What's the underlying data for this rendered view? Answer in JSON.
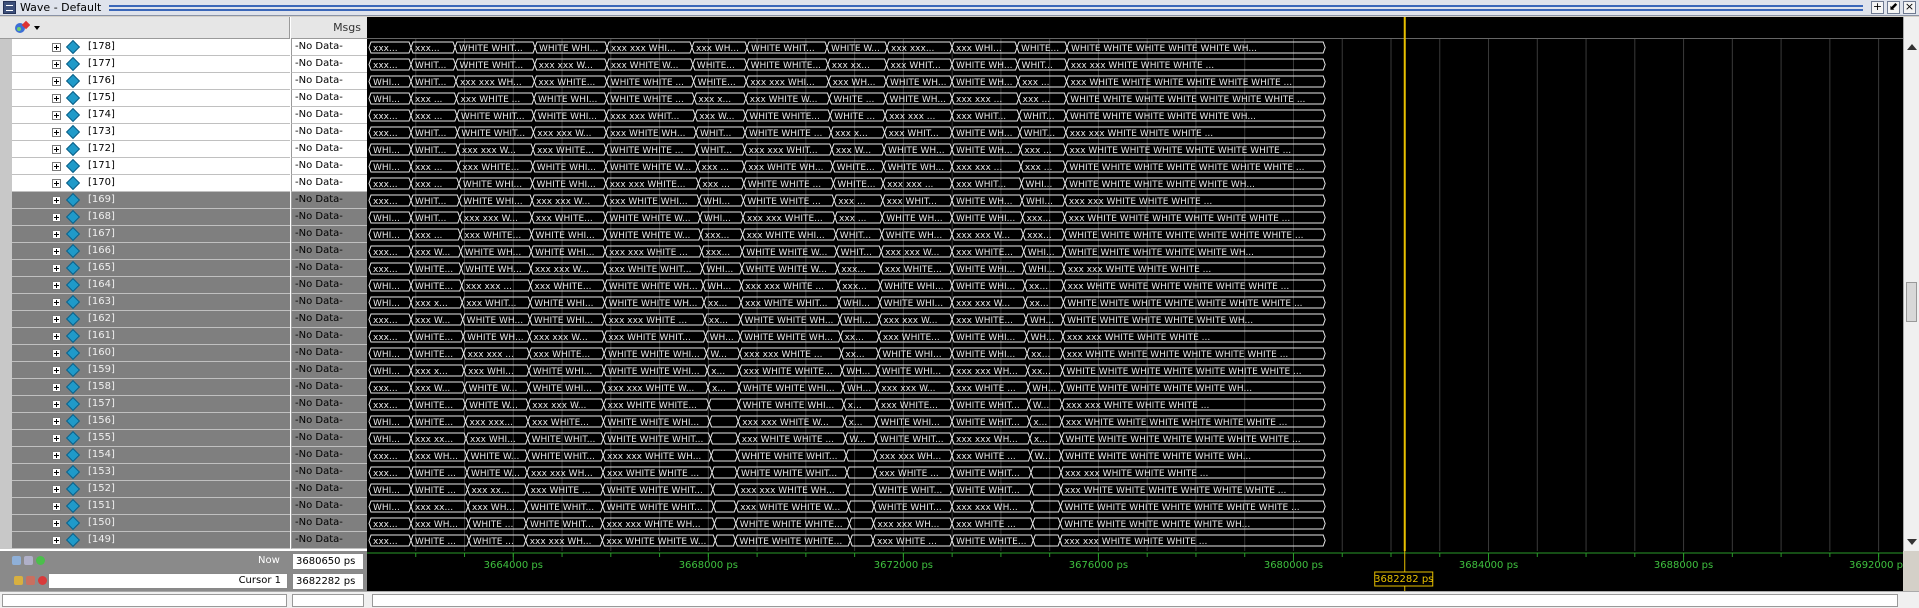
{
  "window": {
    "title": "Wave - Default"
  },
  "title_buttons": [
    "+",
    "⬋",
    "×"
  ],
  "header": {
    "msgs_label": "Msgs"
  },
  "signals": [
    {
      "name": "[178]",
      "msg": "-No Data-",
      "selected": false
    },
    {
      "name": "[177]",
      "msg": "-No Data-",
      "selected": false
    },
    {
      "name": "[176]",
      "msg": "-No Data-",
      "selected": false
    },
    {
      "name": "[175]",
      "msg": "-No Data-",
      "selected": false
    },
    {
      "name": "[174]",
      "msg": "-No Data-",
      "selected": false
    },
    {
      "name": "[173]",
      "msg": "-No Data-",
      "selected": false
    },
    {
      "name": "[172]",
      "msg": "-No Data-",
      "selected": false
    },
    {
      "name": "[171]",
      "msg": "-No Data-",
      "selected": false
    },
    {
      "name": "[170]",
      "msg": "-No Data-",
      "selected": false
    },
    {
      "name": "[169]",
      "msg": "-No Data-",
      "selected": true
    },
    {
      "name": "[168]",
      "msg": "-No Data-",
      "selected": true
    },
    {
      "name": "[167]",
      "msg": "-No Data-",
      "selected": true
    },
    {
      "name": "[166]",
      "msg": "-No Data-",
      "selected": true
    },
    {
      "name": "[165]",
      "msg": "-No Data-",
      "selected": true
    },
    {
      "name": "[164]",
      "msg": "-No Data-",
      "selected": true
    },
    {
      "name": "[163]",
      "msg": "-No Data-",
      "selected": true
    },
    {
      "name": "[162]",
      "msg": "-No Data-",
      "selected": true
    },
    {
      "name": "[161]",
      "msg": "-No Data-",
      "selected": true
    },
    {
      "name": "[160]",
      "msg": "-No Data-",
      "selected": true
    },
    {
      "name": "[159]",
      "msg": "-No Data-",
      "selected": true
    },
    {
      "name": "[158]",
      "msg": "-No Data-",
      "selected": true
    },
    {
      "name": "[157]",
      "msg": "-No Data-",
      "selected": true
    },
    {
      "name": "[156]",
      "msg": "-No Data-",
      "selected": true
    },
    {
      "name": "[155]",
      "msg": "-No Data-",
      "selected": true
    },
    {
      "name": "[154]",
      "msg": "-No Data-",
      "selected": true
    },
    {
      "name": "[153]",
      "msg": "-No Data-",
      "selected": true
    },
    {
      "name": "[152]",
      "msg": "-No Data-",
      "selected": true
    },
    {
      "name": "[151]",
      "msg": "-No Data-",
      "selected": true
    },
    {
      "name": "[150]",
      "msg": "-No Data-",
      "selected": true
    },
    {
      "name": "[149]",
      "msg": "-No Data-",
      "selected": true
    }
  ],
  "wave": {
    "segment_texts": [
      "xxx xxx WHITE WHITE WHITE ...",
      "xxx WHITE WHITE WHITE WHITE WHITE WHITE ...",
      "WHITE WHITE WHITE WHITE WHITE WHITE WHITE ...",
      "WHITE WHITE WHITE WHITE WHITE WH..."
    ],
    "signal_color": "#e8e8e8",
    "grid_color": "#3a3a3a",
    "cursor_color": "#e8c000",
    "data_end_ps": 3680650,
    "cursor_ps": 3682282,
    "view_start_ps": 3661000,
    "view_end_ps": 3692500
  },
  "status": {
    "now_label": "Now",
    "now_value": "3680650 ps",
    "cursor_label": "Cursor 1",
    "cursor_value": "3682282 ps",
    "cursor_flag": "3682282 ps"
  },
  "timeline": {
    "ticks": [
      "3664000 ps",
      "3668000 ps",
      "3672000 ps",
      "3676000 ps",
      "3680000 ps",
      "3684000 ps",
      "3688000 ps",
      "3692000 ps"
    ],
    "tick_values_ps": [
      3664000,
      3668000,
      3672000,
      3676000,
      3680000,
      3684000,
      3688000,
      3692000
    ]
  }
}
